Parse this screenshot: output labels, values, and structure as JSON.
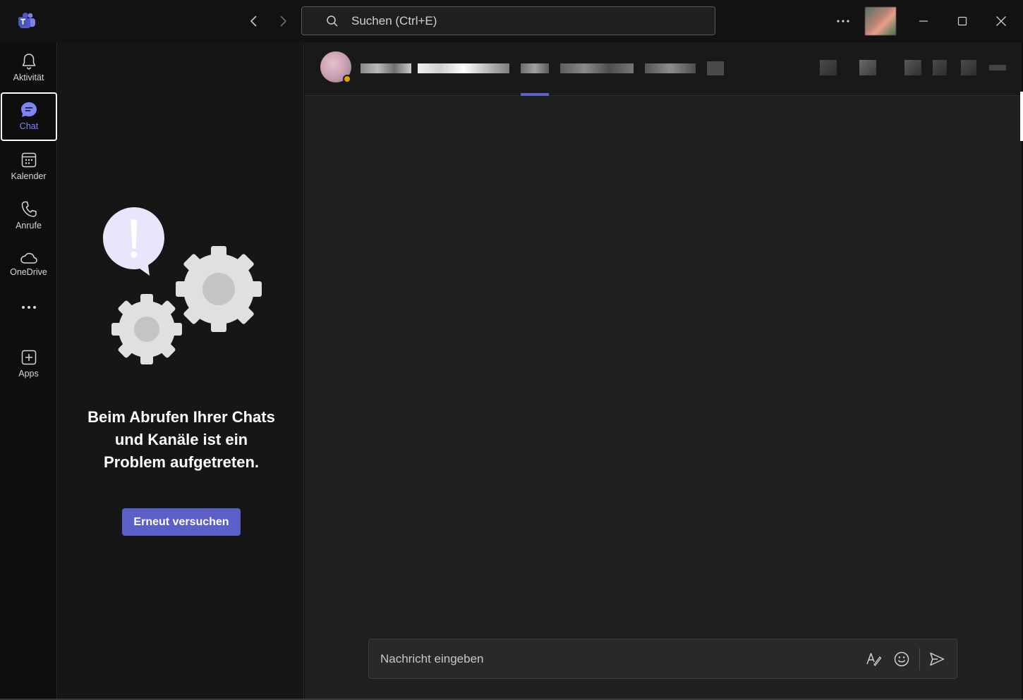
{
  "titlebar": {
    "search_placeholder": "Suchen (Ctrl+E)"
  },
  "rail": {
    "items": [
      {
        "label": "Aktivität",
        "icon": "bell-icon"
      },
      {
        "label": "Chat",
        "icon": "chat-icon",
        "active": true
      },
      {
        "label": "Kalender",
        "icon": "calendar-icon"
      },
      {
        "label": "Anrufe",
        "icon": "phone-icon"
      },
      {
        "label": "OneDrive",
        "icon": "cloud-icon"
      },
      {
        "label": "",
        "icon": "more-icon"
      },
      {
        "label": "Apps",
        "icon": "add-app-icon"
      }
    ]
  },
  "list_pane": {
    "error_message": "Beim Abrufen Ihrer Chats und Kanäle ist ein Problem aufgetreten.",
    "retry_label": "Erneut versuchen"
  },
  "composer": {
    "placeholder": "Nachricht eingeben"
  },
  "colors": {
    "accent": "#5b5fc7",
    "active_label": "#7f85f5",
    "presence_away": "#e3a400"
  }
}
